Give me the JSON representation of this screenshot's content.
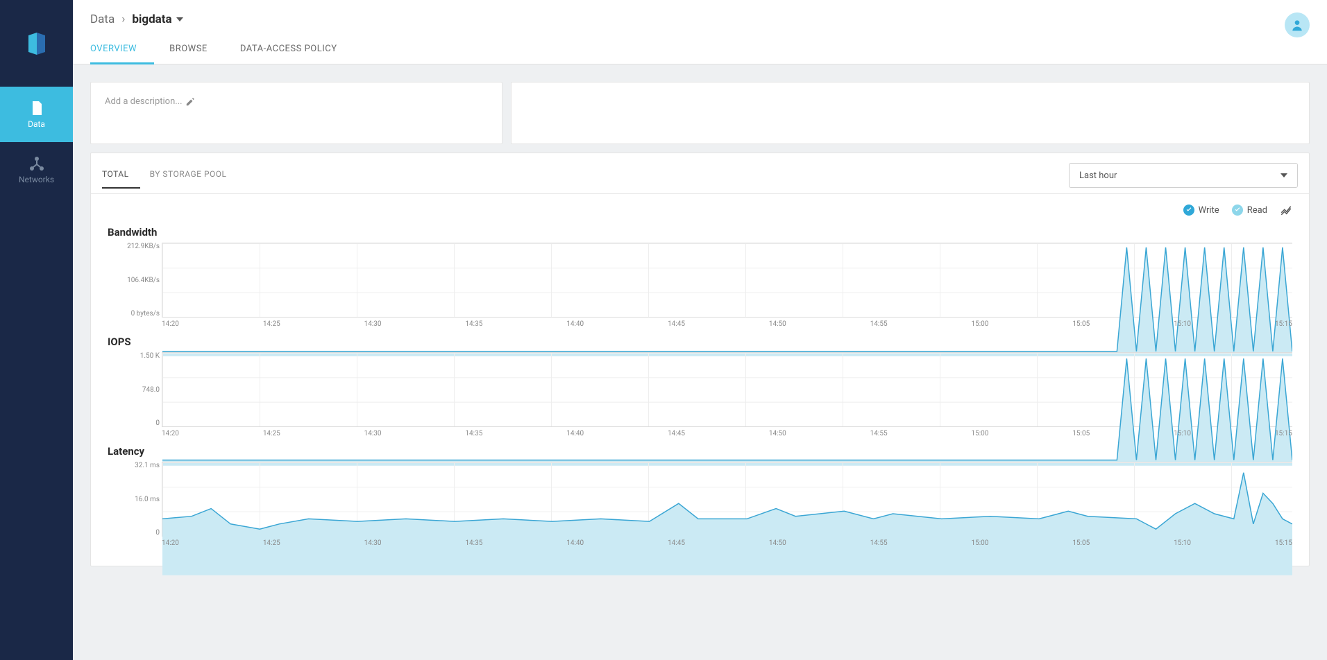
{
  "sidebar": {
    "items": [
      {
        "id": "data",
        "label": "Data"
      },
      {
        "id": "networks",
        "label": "Networks"
      }
    ]
  },
  "breadcrumb": {
    "root": "Data",
    "current": "bigdata"
  },
  "tabs": [
    {
      "id": "overview",
      "label": "OVERVIEW",
      "active": true
    },
    {
      "id": "browse",
      "label": "BROWSE"
    },
    {
      "id": "policy",
      "label": "DATA-ACCESS POLICY"
    }
  ],
  "description": {
    "placeholder": "Add a description..."
  },
  "perf": {
    "subtabs": [
      {
        "id": "total",
        "label": "TOTAL",
        "active": true
      },
      {
        "id": "pool",
        "label": "BY STORAGE POOL"
      }
    ],
    "timerange": "Last hour",
    "legend": {
      "write": "Write",
      "read": "Read"
    }
  },
  "chart_data": [
    {
      "type": "area",
      "title": "Bandwidth",
      "series_name": "Write",
      "ylabels": [
        "212.9KB/s",
        "106.4KB/s",
        "0 bytes/s"
      ],
      "xlabels": [
        "14:20",
        "14:25",
        "14:30",
        "14:35",
        "14:40",
        "14:45",
        "14:50",
        "14:55",
        "15:00",
        "15:05",
        "15:10",
        "15:15"
      ],
      "x": [
        0,
        1,
        2,
        3,
        4,
        5,
        6,
        7,
        8,
        9,
        9.8,
        9.9,
        10,
        10.1,
        10.2,
        10.3,
        10.4,
        10.5,
        10.6,
        10.7,
        10.8,
        10.9,
        11,
        11.1,
        11.2,
        11.3,
        11.4,
        11.5,
        11.6
      ],
      "y": [
        12,
        12,
        12,
        12,
        12,
        12,
        12,
        12,
        12,
        12,
        12,
        270,
        12,
        270,
        12,
        270,
        12,
        270,
        12,
        270,
        12,
        270,
        12,
        270,
        12,
        270,
        12,
        270,
        12
      ],
      "ylim": [
        0,
        280
      ],
      "xlim": [
        0,
        11.6
      ],
      "ylabel": "",
      "xlabel": ""
    },
    {
      "type": "area",
      "title": "IOPS",
      "series_name": "Write",
      "ylabels": [
        "1.50 K",
        "748.0",
        "0"
      ],
      "xlabels": [
        "14:20",
        "14:25",
        "14:30",
        "14:35",
        "14:40",
        "14:45",
        "14:50",
        "14:55",
        "15:00",
        "15:05",
        "15:10",
        "15:15"
      ],
      "x": [
        0,
        1,
        2,
        3,
        4,
        5,
        6,
        7,
        8,
        9,
        9.8,
        9.9,
        10,
        10.1,
        10.2,
        10.3,
        10.4,
        10.5,
        10.6,
        10.7,
        10.8,
        10.9,
        11,
        11.1,
        11.2,
        11.3,
        11.4,
        11.5,
        11.6
      ],
      "y": [
        100,
        100,
        100,
        100,
        100,
        100,
        100,
        100,
        100,
        100,
        100,
        1900,
        100,
        1900,
        100,
        1900,
        100,
        1900,
        100,
        1900,
        100,
        1900,
        100,
        1900,
        100,
        1900,
        100,
        1900,
        100
      ],
      "ylim": [
        0,
        2000
      ],
      "xlim": [
        0,
        11.6
      ],
      "ylabel": "",
      "xlabel": ""
    },
    {
      "type": "area",
      "title": "Latency",
      "series_name": "Write",
      "ylabels": [
        "32.1 ms",
        "16.0 ms",
        "0"
      ],
      "xlabels": [
        "14:20",
        "14:25",
        "14:30",
        "14:35",
        "14:40",
        "14:45",
        "14:50",
        "14:55",
        "15:00",
        "15:05",
        "15:10",
        "15:15"
      ],
      "x": [
        0,
        0.3,
        0.5,
        0.7,
        1.0,
        1.2,
        1.5,
        2.0,
        2.5,
        3.0,
        3.5,
        4.0,
        4.5,
        5.0,
        5.3,
        5.5,
        6.0,
        6.3,
        6.5,
        7.0,
        7.3,
        7.5,
        8.0,
        8.5,
        9.0,
        9.3,
        9.5,
        10.0,
        10.2,
        10.4,
        10.6,
        10.8,
        11.0,
        11.1,
        11.2,
        11.3,
        11.4,
        11.5,
        11.6
      ],
      "y": [
        22,
        23,
        26,
        20,
        18,
        20,
        22,
        21,
        22,
        21,
        22,
        21,
        22,
        21,
        28,
        22,
        22,
        26,
        23,
        25,
        22,
        24,
        22,
        23,
        22,
        25,
        23,
        22,
        18,
        24,
        28,
        24,
        22,
        40,
        20,
        32,
        28,
        22,
        20
      ],
      "ylim": [
        0,
        44
      ],
      "xlim": [
        0,
        11.6
      ],
      "ylabel": "",
      "xlabel": ""
    }
  ]
}
